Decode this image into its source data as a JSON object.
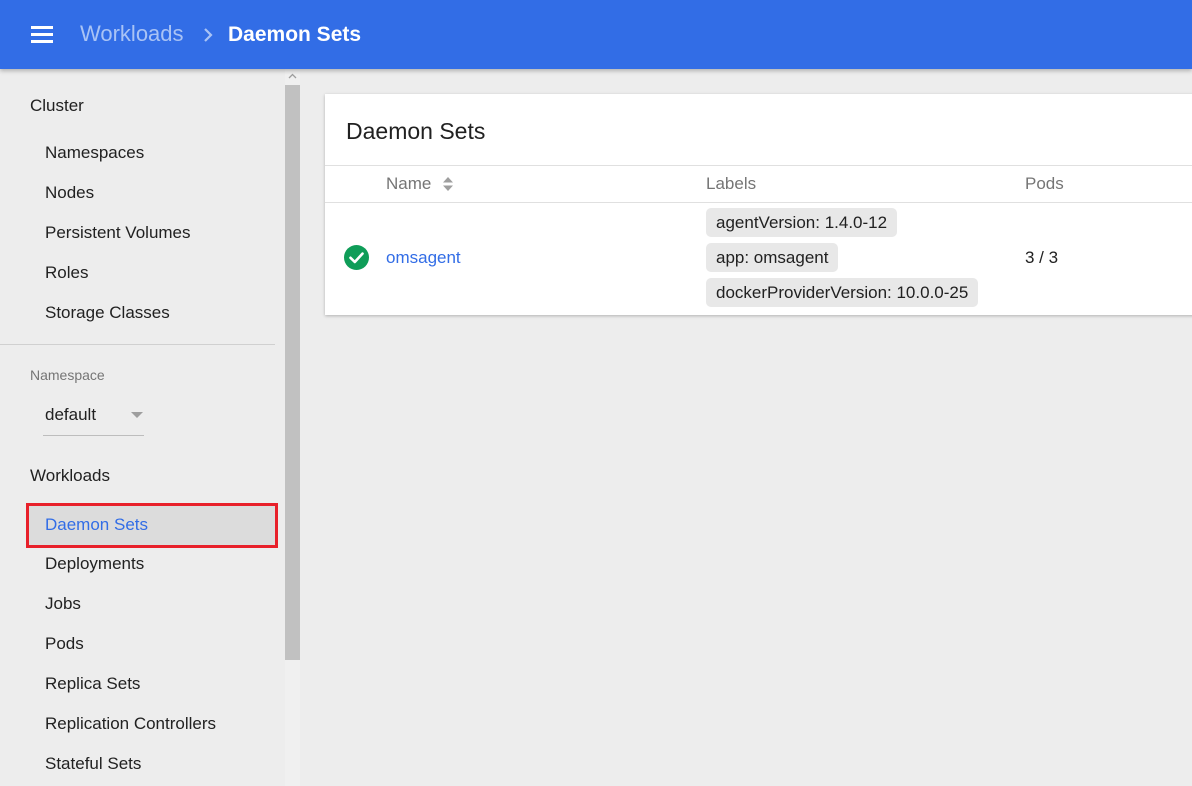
{
  "topbar": {
    "breadcrumb_parent": "Workloads",
    "breadcrumb_current": "Daemon Sets"
  },
  "sidebar": {
    "cluster_title": "Cluster",
    "cluster_items": [
      {
        "label": "Namespaces"
      },
      {
        "label": "Nodes"
      },
      {
        "label": "Persistent Volumes"
      },
      {
        "label": "Roles"
      },
      {
        "label": "Storage Classes"
      }
    ],
    "namespace_label": "Namespace",
    "namespace_value": "default",
    "workloads_title": "Workloads",
    "workload_items": [
      {
        "label": "Daemon Sets"
      },
      {
        "label": "Deployments"
      },
      {
        "label": "Jobs"
      },
      {
        "label": "Pods"
      },
      {
        "label": "Replica Sets"
      },
      {
        "label": "Replication Controllers"
      },
      {
        "label": "Stateful Sets"
      }
    ]
  },
  "card": {
    "title": "Daemon Sets",
    "columns": {
      "name": "Name",
      "labels": "Labels",
      "pods": "Pods"
    },
    "rows": [
      {
        "status": "check-circle-icon",
        "name": "omsagent",
        "labels": [
          "agentVersion: 1.4.0-12",
          "app: omsagent",
          "dockerProviderVersion: 10.0.0-25"
        ],
        "pods": "3 / 3"
      }
    ]
  },
  "colors": {
    "brand": "#326de6",
    "success": "#0f9d58",
    "highlight": "#e8202a"
  }
}
